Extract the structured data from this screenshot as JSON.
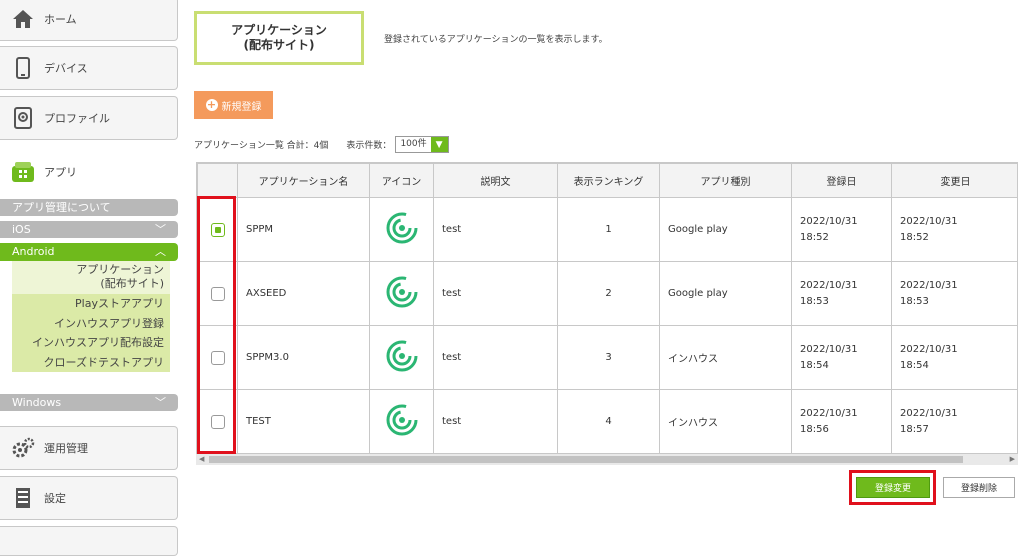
{
  "sidebar": {
    "home": "ホーム",
    "device": "デバイス",
    "profile": "プロファイル",
    "app": "アプリ",
    "app_about": "アプリ管理について",
    "ios": "iOS",
    "android": "Android",
    "android_items": [
      "アプリケーション\n(配布サイト)",
      "Playストアアプリ",
      "インハウスアプリ登録",
      "インハウスアプリ配布設定",
      "クローズドテストアプリ"
    ],
    "windows": "Windows",
    "operation": "運用管理",
    "settings": "設定"
  },
  "page": {
    "title_line1": "アプリケーション",
    "title_line2": "(配布サイト)",
    "subtitle": "登録されているアプリケーションの一覧を表示します。",
    "new_button": "新規登録",
    "summary": "アプリケーション一覧 合計：4個",
    "count_label": "表示件数：",
    "count_value": "100件"
  },
  "table": {
    "headers": [
      "",
      "アプリケーション名",
      "アイコン",
      "説明文",
      "表示ランキング",
      "アプリ種別",
      "登録日",
      "変更日"
    ],
    "rows": [
      {
        "checked": true,
        "name": "SPPM",
        "desc": "test",
        "rank": "1",
        "kind": "Google play",
        "reg": "2022/10/31\n18:52",
        "mod": "2022/10/31\n18:52"
      },
      {
        "checked": false,
        "name": "AXSEED",
        "desc": "test",
        "rank": "2",
        "kind": "Google play",
        "reg": "2022/10/31\n18:53",
        "mod": "2022/10/31\n18:53"
      },
      {
        "checked": false,
        "name": "SPPM3.0",
        "desc": "test",
        "rank": "3",
        "kind": "インハウス",
        "reg": "2022/10/31\n18:54",
        "mod": "2022/10/31\n18:54"
      },
      {
        "checked": false,
        "name": "TEST",
        "desc": "test",
        "rank": "4",
        "kind": "インハウス",
        "reg": "2022/10/31\n18:56",
        "mod": "2022/10/31\n18:57"
      }
    ]
  },
  "buttons": {
    "update": "登録変更",
    "delete": "登録削除"
  },
  "colors": {
    "accent_green": "#6fba1c",
    "highlight_red": "#e0101c",
    "orange": "#f49a5c"
  }
}
